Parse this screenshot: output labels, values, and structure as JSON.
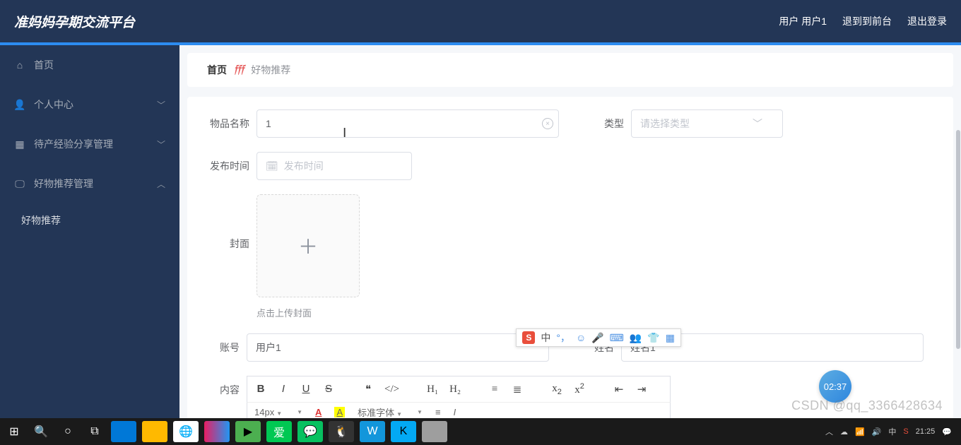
{
  "header": {
    "brand": "准妈妈孕期交流平台",
    "user": "用户 用户1",
    "to_front": "退到到前台",
    "logout": "退出登录"
  },
  "sidebar": {
    "home": "首页",
    "personal": "个人中心",
    "share_mgmt": "待产经验分享管理",
    "rec_mgmt": "好物推荐管理",
    "rec_sub": "好物推荐"
  },
  "crumb": {
    "home": "首页",
    "current": "好物推荐"
  },
  "form": {
    "name_label": "物品名称",
    "name_value": "1",
    "type_label": "类型",
    "type_placeholder": "请选择类型",
    "publish_label": "发布时间",
    "publish_placeholder": "发布时间",
    "cover_label": "封面",
    "cover_hint": "点击上传封面",
    "account_label": "账号",
    "account_value": "用户1",
    "realname_label": "姓名",
    "realname_value": "姓名1",
    "content_label": "内容"
  },
  "editor": {
    "size": "14px",
    "fontlabel": "标准字体"
  },
  "ime": {
    "logo": "S",
    "mode": "中"
  },
  "timer": "02:37",
  "watermark": "CSDN @qq_3366428634",
  "taskbar": {
    "time": "21:25"
  }
}
